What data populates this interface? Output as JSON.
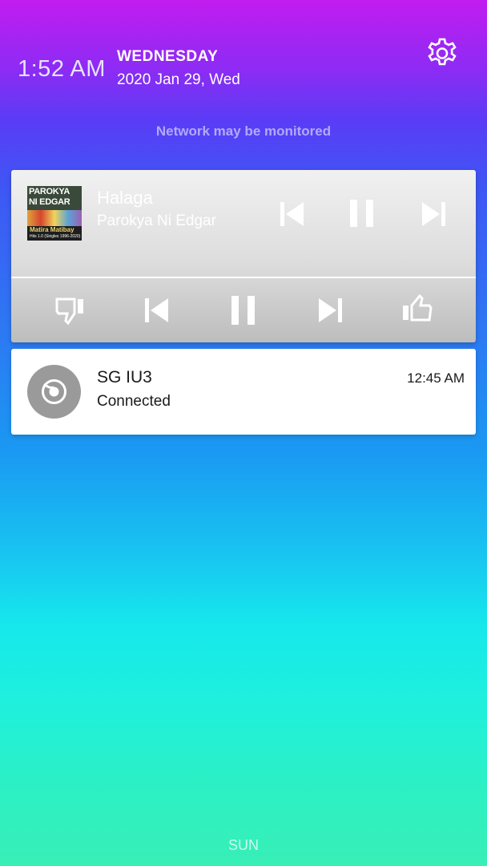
{
  "status_bar": {
    "time": "1:52 AM",
    "day": "WEDNESDAY",
    "date": "2020 Jan 29, Wed",
    "settings_icon": "gear-icon",
    "network_notice": "Network may be monitored"
  },
  "media_player": {
    "song_title": "Halaga",
    "artist": "Parokya Ni Edgar",
    "album_art": {
      "line1": "PAROKYA",
      "line2": "NI EDGAR",
      "line3": "Matira Matibay",
      "line4": "Hits 1.0 (Singles 1996-2020)"
    },
    "top_controls": [
      "skip-previous-icon",
      "pause-icon",
      "skip-next-icon"
    ],
    "bottom_controls": [
      "thumbs-down-icon",
      "skip-previous-icon",
      "pause-icon",
      "skip-next-icon",
      "thumbs-up-icon"
    ]
  },
  "notification": {
    "title": "SG IU3",
    "text": "Connected",
    "time": "12:45 AM",
    "icon": "app-icon"
  },
  "footer": {
    "label": "SUN"
  },
  "colors": {
    "gradient_top": "#c21cf0",
    "gradient_mid": "#2b7cf3",
    "gradient_bottom": "#38efb6",
    "card_white": "#ffffff"
  }
}
